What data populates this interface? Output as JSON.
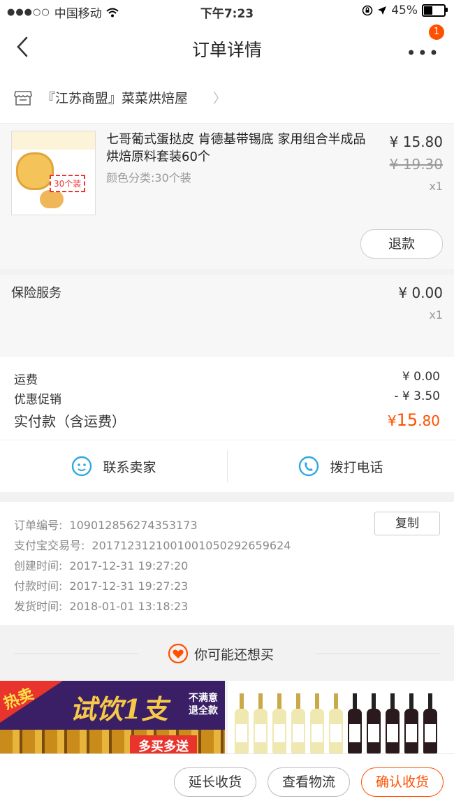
{
  "status_bar": {
    "carrier": "中国移动",
    "time": "下午7:23",
    "battery": "45%"
  },
  "navbar": {
    "title": "订单详情",
    "badge": "1"
  },
  "shop": {
    "name": "『江苏商盟』菜菜烘焙屋"
  },
  "item": {
    "title": "七哥葡式蛋挞皮 肯德基带锡底 家用组合半成品烘焙原料套装60个",
    "spec": "颜色分类:30个装",
    "image_tag": "30个装",
    "price": "¥ 15.80",
    "original_price": "¥ 19.30",
    "qty": "x1",
    "refund_label": "退款"
  },
  "insurance": {
    "label": "保险服务",
    "price": "¥ 0.00",
    "qty": "x1"
  },
  "fees": {
    "shipping_label": "运费",
    "shipping_value": "¥ 0.00",
    "discount_label": "优惠促销",
    "discount_value": "- ¥ 3.50",
    "total_label": "实付款（含运费）",
    "total_currency": "¥",
    "total_int": "15",
    "total_dec": ".80"
  },
  "contact": {
    "seller_label": "联系卖家",
    "phone_label": "拨打电话"
  },
  "order_info": {
    "order_no_label": "订单编号:",
    "order_no": "109012856274353173",
    "alipay_label": "支付宝交易号:",
    "alipay_no": "2017123121001001050292659624",
    "created_label": "创建时间:",
    "created": "2017-12-31 19:27:20",
    "paid_label": "付款时间:",
    "paid": "2017-12-31 19:27:23",
    "shipped_label": "发货时间:",
    "shipped": "2018-01-01 13:18:23",
    "copy_label": "复制"
  },
  "recommend": {
    "title": "你可能还想买"
  },
  "banner": {
    "hot": "热卖",
    "main": "试饮1支",
    "side_1": "不满意",
    "side_2": "退全款",
    "promo": "多买多送"
  },
  "actions": {
    "extend": "延长收货",
    "logistics": "查看物流",
    "confirm": "确认收货"
  },
  "colors": {
    "accent": "#ff5000",
    "contact_icon": "#2fa8e0"
  }
}
